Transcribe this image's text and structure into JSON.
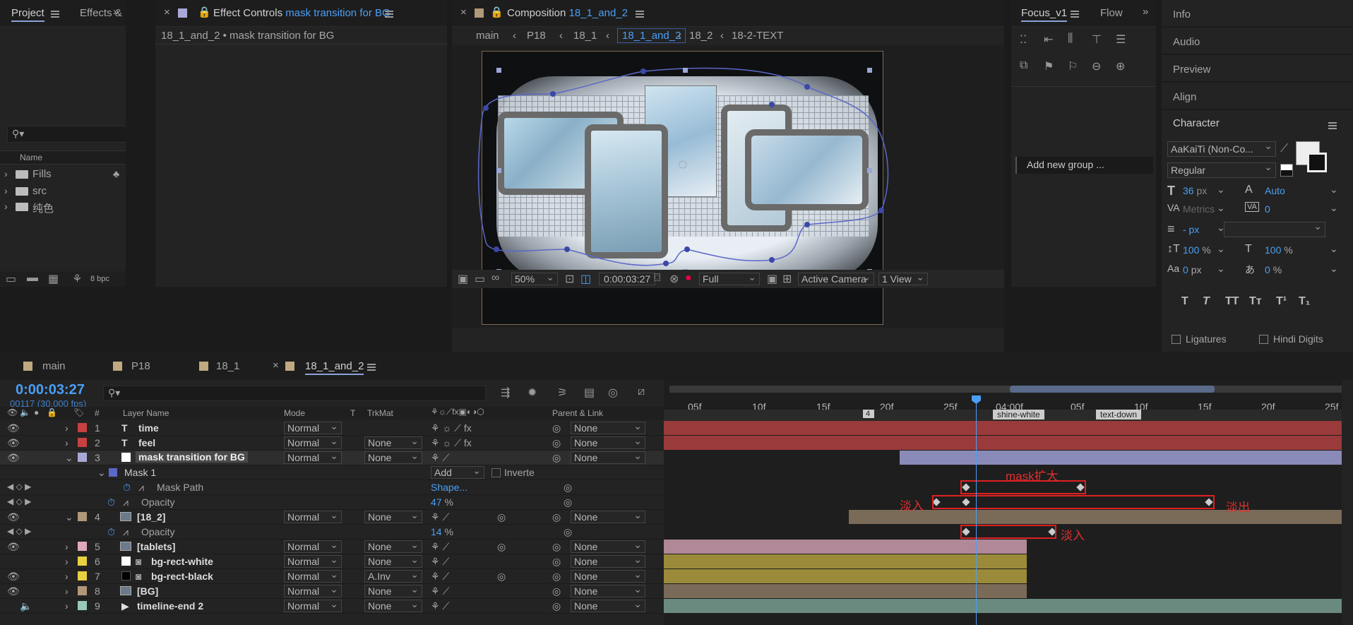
{
  "project_panel": {
    "tabs": [
      "Project",
      "Effects &"
    ],
    "search_placeholder": "",
    "column_name": "Name",
    "items": [
      "Fills",
      "src",
      "纯色"
    ],
    "bpc": "8 bpc"
  },
  "effect_controls": {
    "tab_label": "Effect Controls",
    "layer_name": "mask transition for BG",
    "breadcrumb": "18_1_and_2 • mask transition for BG"
  },
  "composition": {
    "tab_label": "Composition",
    "comp_name": "18_1_and_2",
    "nav": [
      "main",
      "P18",
      "18_1",
      "18_1_and_2",
      "18_2",
      "18-2-TEXT"
    ],
    "zoom": "50%",
    "timecode": "0:00:03:27",
    "resolution": "Full",
    "camera": "Active Camera",
    "views": "1 View"
  },
  "focus_panel": {
    "tabs": [
      "Focus_v1",
      "Flow"
    ],
    "add_group": "Add new group ..."
  },
  "right_panel": {
    "items": [
      "Info",
      "Audio",
      "Preview",
      "Align",
      "Character"
    ],
    "font": "AaKaiTi (Non-Co...",
    "style": "Regular",
    "size": "36",
    "size_unit": "px",
    "leading": "Auto",
    "kerning": "Metrics",
    "tracking": "0",
    "stroke_unit": "- px",
    "vscale": "100",
    "hscale": "100",
    "pct": "%",
    "baseline": "0",
    "baseline_unit": "px",
    "tsume": "0",
    "tsume_unit": "%",
    "ligatures": "Ligatures",
    "hindi": "Hindi Digits",
    "type_buttons": [
      "T",
      "T",
      "TT",
      "Tт",
      "T¹",
      "T₁"
    ]
  },
  "timeline": {
    "tabs": [
      "main",
      "P18",
      "18_1",
      "18_1_and_2"
    ],
    "timecode": "0:00:03:27",
    "frames": "00117 (30.000 fps)",
    "col_hash": "#",
    "col_layer": "Layer Name",
    "col_mode": "Mode",
    "col_t": "T",
    "col_trkmat": "TrkMat",
    "col_parent": "Parent & Link",
    "ruler": [
      "05f",
      "10f",
      "15f",
      "20f",
      "25f",
      "04:00f",
      "05f",
      "10f",
      "15f",
      "20f",
      "25f"
    ],
    "markers": [
      "4",
      "shine-white",
      "text-down"
    ],
    "layers": [
      {
        "num": "1",
        "name": "time",
        "color": "#c84040",
        "type": "T",
        "mode": "Normal",
        "trkmat": "",
        "parent": "None"
      },
      {
        "num": "2",
        "name": "feel",
        "color": "#c84040",
        "type": "T",
        "mode": "Normal",
        "trkmat": "None",
        "parent": "None"
      },
      {
        "num": "3",
        "name": "mask transition for BG",
        "color": "#a8a8d8",
        "type": "solid",
        "mode": "Normal",
        "trkmat": "None",
        "parent": "None"
      },
      {
        "num": "4",
        "name": "[18_2]",
        "color": "#b09878",
        "type": "comp",
        "mode": "Normal",
        "trkmat": "None",
        "parent": "None"
      },
      {
        "num": "5",
        "name": "[tablets]",
        "color": "#e0a8b8",
        "type": "comp",
        "mode": "Normal",
        "trkmat": "None",
        "parent": "None"
      },
      {
        "num": "6",
        "name": "bg-rect-white",
        "color": "#e8d040",
        "type": "shape",
        "mode": "Normal",
        "trkmat": "None",
        "parent": "None"
      },
      {
        "num": "7",
        "name": "bg-rect-black",
        "color": "#e8d040",
        "type": "shape",
        "mode": "Normal",
        "trkmat": "A.Inv",
        "parent": "None"
      },
      {
        "num": "8",
        "name": "[BG]",
        "color": "#b09878",
        "type": "comp",
        "mode": "Normal",
        "trkmat": "None",
        "parent": "None"
      },
      {
        "num": "9",
        "name": "timeline-end 2",
        "color": "#98c8b8",
        "type": "audio",
        "mode": "Normal",
        "trkmat": "None",
        "parent": "None"
      }
    ],
    "mask_name": "Mask 1",
    "mask_mode": "Add",
    "mask_inverted": "Inverte",
    "mask_path": "Mask Path",
    "mask_path_value": "Shape...",
    "opacity_label": "Opacity",
    "opacity1": "47",
    "opacity2": "14",
    "pct": "%",
    "annotations": [
      "mask扩大",
      "淡入",
      "淡出",
      "淡入"
    ]
  },
  "colors": {
    "accent": "#4a9ff5",
    "annotation": "#e02020"
  }
}
